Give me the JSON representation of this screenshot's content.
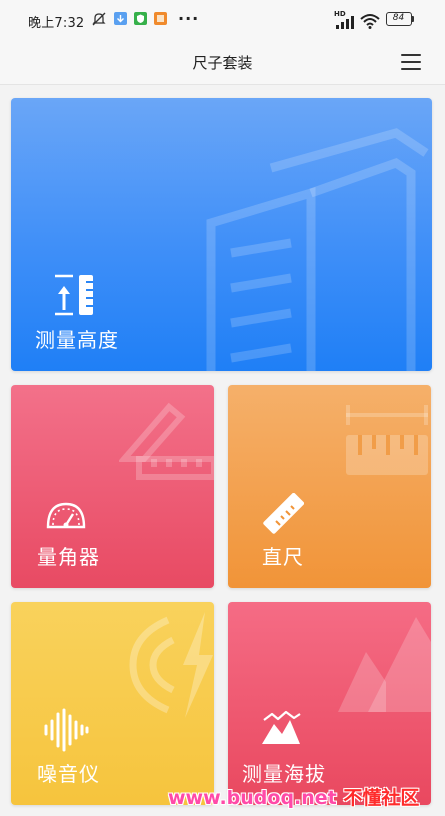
{
  "status_bar": {
    "time": "晚上7:32",
    "extra_icons": "···",
    "network_badge": "HD",
    "battery": "84"
  },
  "header": {
    "title": "尺子套装"
  },
  "cards": {
    "height": {
      "label": "测量高度"
    },
    "protractor": {
      "label": "量角器"
    },
    "ruler": {
      "label": "直尺"
    },
    "noise": {
      "label": "噪音仪"
    },
    "altitude": {
      "label": "测量海拔"
    }
  },
  "watermark": {
    "url": "www.budoq.net",
    "name": "不懂社区"
  },
  "icons": [
    "mute-icon",
    "download-icon",
    "shield-icon",
    "app-icon",
    "signal-icon",
    "wifi-icon",
    "battery-icon",
    "menu-icon",
    "height-ruler-icon",
    "speedometer-icon",
    "ruler-icon",
    "sound-wave-icon",
    "mountain-icon"
  ],
  "colors": {
    "height_card": "#3f8ff8",
    "protractor_card": "#e84a63",
    "ruler_card": "#f19438",
    "noise_card": "#f6c43d",
    "altitude_card": "#e9485f"
  }
}
